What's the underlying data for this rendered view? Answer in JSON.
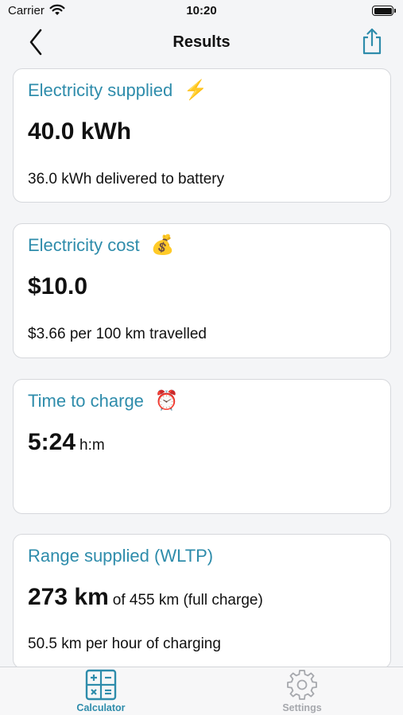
{
  "status_bar": {
    "carrier": "Carrier",
    "time": "10:20",
    "icons": [
      "wifi-icon",
      "battery-icon"
    ]
  },
  "nav": {
    "title": "Results",
    "back_icon": "chevron-left-icon",
    "share_icon": "share-icon",
    "accent_color": "#2e8cab"
  },
  "cards": {
    "electricity_supplied": {
      "title": "Electricity supplied",
      "emoji": "⚡",
      "value": "40.0 kWh",
      "detail": "36.0 kWh delivered to battery"
    },
    "electricity_cost": {
      "title": "Electricity cost",
      "emoji": "💰",
      "value": "$10.0",
      "detail": "$3.66 per 100 km travelled"
    },
    "time_to_charge": {
      "title": "Time to charge",
      "emoji": "⏰",
      "value": "5:24",
      "unit": "h:m"
    },
    "range_supplied": {
      "title": "Range supplied (WLTP)",
      "value": "273 km",
      "suffix": "of 455 km (full charge)",
      "detail": "50.5 km per hour of charging"
    }
  },
  "tab_bar": {
    "tabs": [
      {
        "label": "Calculator",
        "icon": "calculator-icon",
        "selected": true,
        "color": "#2e8cab"
      },
      {
        "label": "Settings",
        "icon": "gear-icon",
        "selected": false,
        "color": "#a6a8ad"
      }
    ]
  }
}
